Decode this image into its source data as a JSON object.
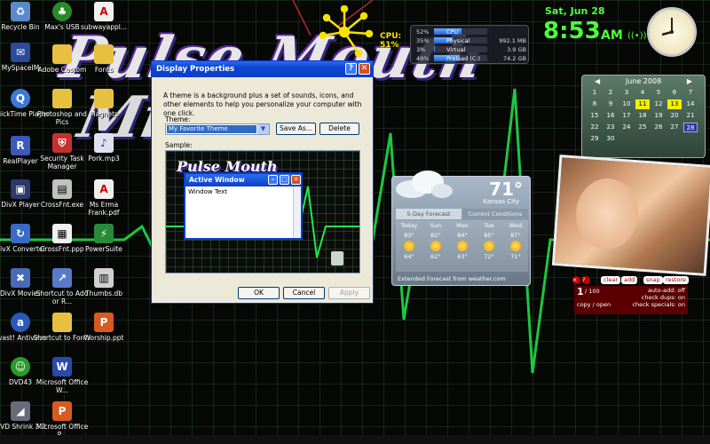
{
  "desktop_icons": [
    {
      "label": "Recycle Bin",
      "glyph": "recycle-icon"
    },
    {
      "label": "MySpaceIM",
      "glyph": "myspaceim-icon"
    },
    {
      "label": "QuickTime Player",
      "glyph": "quicktime-icon"
    },
    {
      "label": "RealPlayer",
      "glyph": "realplayer-icon"
    },
    {
      "label": "DivX Player",
      "glyph": "divx-icon"
    },
    {
      "label": "DivX Converter",
      "glyph": "divx-converter-icon"
    },
    {
      "label": "DivX Movies",
      "glyph": "divx-movies-icon"
    },
    {
      "label": "avast! Antivirus",
      "glyph": "avast-icon"
    },
    {
      "label": "DVD43",
      "glyph": "dvd43-icon"
    },
    {
      "label": "DVD Shrink 3.2",
      "glyph": "dvdshrink-icon"
    },
    {
      "label": "Max's USB",
      "glyph": "usb-icon"
    },
    {
      "label": "Adobe Costom",
      "glyph": "folder-icon"
    },
    {
      "label": "Photoshop and Pics",
      "glyph": "folder-icon"
    },
    {
      "label": "Security Task Manager",
      "glyph": "security-icon"
    },
    {
      "label": "CrossFnt.exe",
      "glyph": "exe-icon"
    },
    {
      "label": "CrossFnt.ppp",
      "glyph": "file-icon"
    },
    {
      "label": "Shortcut to Add or R...",
      "glyph": "shortcut-icon"
    },
    {
      "label": "Shortcut to Fonts",
      "glyph": "folder-icon"
    },
    {
      "label": "Microsoft Office W...",
      "glyph": "word-icon"
    },
    {
      "label": "Microsoft Office P...",
      "glyph": "powerpoint-icon"
    },
    {
      "label": "subwayappl...",
      "glyph": "pdf-icon"
    },
    {
      "label": "Fonts",
      "glyph": "folder-icon"
    },
    {
      "label": "Magnets",
      "glyph": "folder-icon"
    },
    {
      "label": "Pork.mp3",
      "glyph": "audio-icon"
    },
    {
      "label": "Ms Erma Frank.pdf",
      "glyph": "pdf-icon"
    },
    {
      "label": "PowerSuite",
      "glyph": "powersuite-icon"
    },
    {
      "label": "Thumbs.db",
      "glyph": "db-icon"
    },
    {
      "label": "Worship.ppt",
      "glyph": "powerpoint-icon"
    }
  ],
  "window": {
    "title": "Display Properties",
    "help_btn": "?",
    "close_btn": "✕",
    "description": "A theme is a background plus a set of sounds, icons, and other elements to help you personalize your computer with one click.",
    "theme_label": "Theme:",
    "theme_value": "My Favorite Theme",
    "save_as": "Save As...",
    "delete": "Delete",
    "sample_label": "Sample:",
    "ok": "OK",
    "cancel": "Cancel",
    "apply": "Apply",
    "sample": {
      "mini_title": "Pulse Mouth",
      "active_window_title": "Active Window",
      "window_text": "Window Text"
    }
  },
  "wallpaper": {
    "title_line1": "Pulse Mouth",
    "title_line2": "Mi"
  },
  "cpu": {
    "label": "CPU:",
    "value": "51%"
  },
  "meters": [
    {
      "pct": "52%",
      "name": "CPU",
      "size": "",
      "fill": 0.52
    },
    {
      "pct": "35%",
      "name": "Physical",
      "size": "992.1 MB",
      "fill": 0.35
    },
    {
      "pct": "1%",
      "name": "Virtual",
      "size": "3.9 GB",
      "fill": 0.01
    },
    {
      "pct": "49%",
      "name": "Preload (C:)",
      "size": "74.2 GB",
      "fill": 0.49
    }
  ],
  "clock": {
    "date": "Sat, Jun 28",
    "time": "8:53",
    "ampm": "AM"
  },
  "calendar": {
    "month": "June 2008",
    "days": [
      "1",
      "2",
      "3",
      "4",
      "5",
      "6",
      "7",
      "8",
      "9",
      "10",
      "11",
      "12",
      "13",
      "14",
      "15",
      "16",
      "17",
      "18",
      "19",
      "20",
      "21",
      "22",
      "23",
      "24",
      "25",
      "26",
      "27",
      "28",
      "29",
      "30"
    ]
  },
  "weather": {
    "temp": "71°",
    "city": "Kansas City",
    "tab_forecast": "5-Day Forecast",
    "tab_current": "Current Conditions",
    "forecast": [
      {
        "day": "Today",
        "hi": "83°",
        "lo": "64°"
      },
      {
        "day": "Sun",
        "hi": "82°",
        "lo": "62°"
      },
      {
        "day": "Mon",
        "hi": "84°",
        "lo": "63°"
      },
      {
        "day": "Tue",
        "hi": "85°",
        "lo": "72°"
      },
      {
        "day": "Wed",
        "hi": "87°",
        "lo": "71°"
      }
    ],
    "credit": "Extended Forecast from weather.com"
  },
  "clipboard": {
    "buttons": [
      "clear",
      "add",
      "snap",
      "restore"
    ],
    "count": "1",
    "total": "/ 100",
    "autoadd": "auto-add: off",
    "dups": "check dups: on",
    "copyopen": "copy / open",
    "specials": "check specials: on"
  }
}
